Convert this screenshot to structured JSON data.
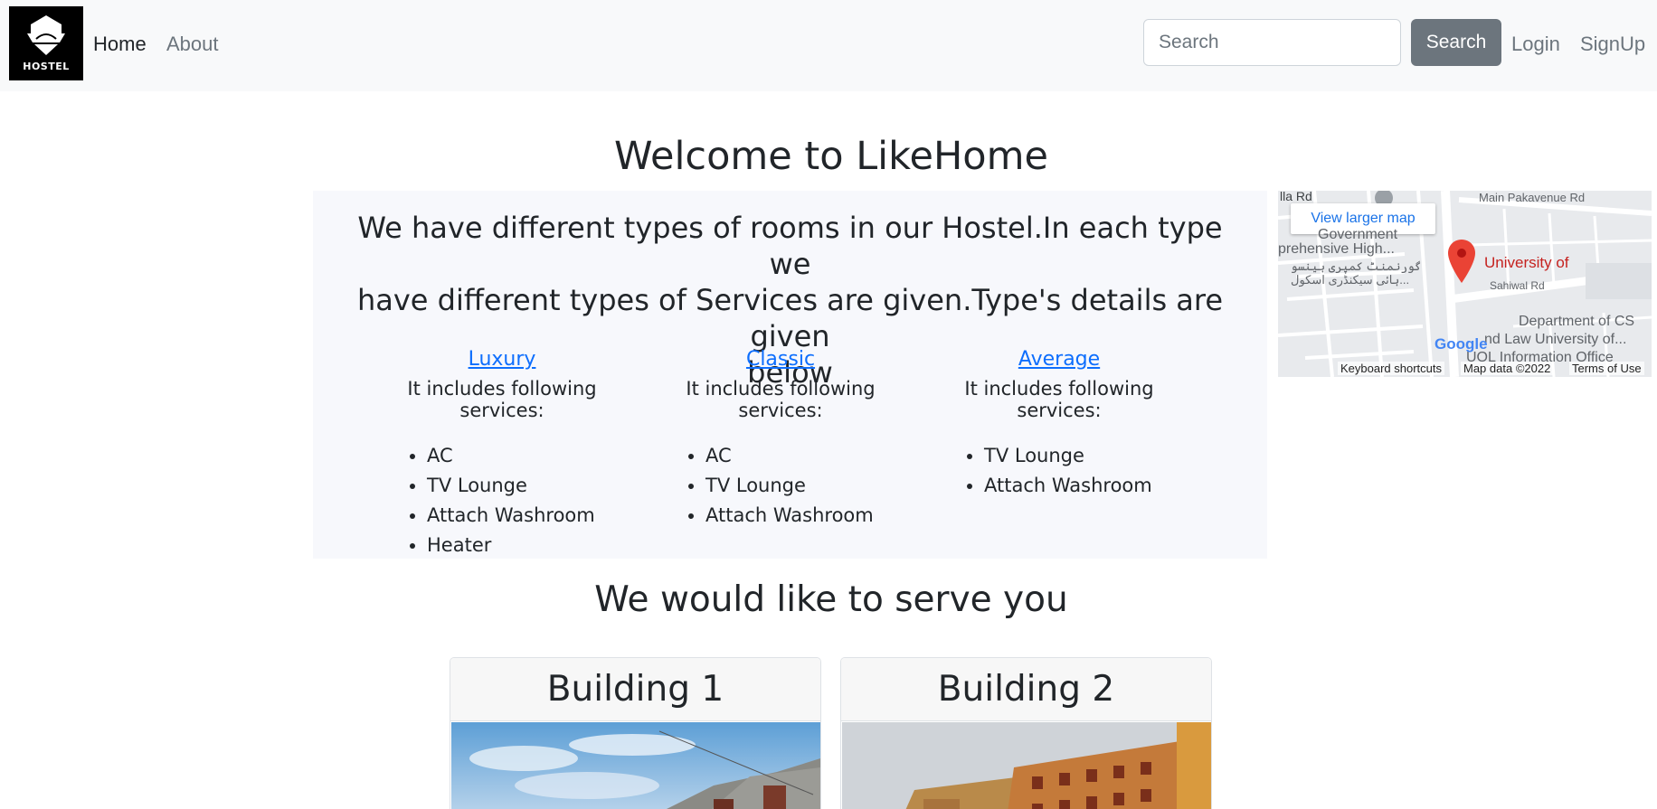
{
  "navbar": {
    "logo_text": "HOSTEL",
    "links": [
      "Home",
      "About"
    ],
    "search_placeholder": "Search",
    "search_button": "Search",
    "login": "Login",
    "signup": "SignUp"
  },
  "main": {
    "title": "Welcome to LikeHome",
    "intro_lines": [
      "We have different types of rooms in our Hostel.In each type we",
      "have different types of Services are given.Type's details are given",
      "below"
    ],
    "types": [
      {
        "name": "Luxury",
        "subtitle": "It includes following services:",
        "services": [
          "AC",
          "TV Lounge",
          "Attach Washroom",
          "Heater"
        ]
      },
      {
        "name": "Classic",
        "subtitle": "It includes following services:",
        "services": [
          "AC",
          "TV Lounge",
          "Attach Washroom"
        ]
      },
      {
        "name": "Average",
        "subtitle": "It includes following services:",
        "services": [
          "TV Lounge",
          "Attach Washroom"
        ]
      }
    ]
  },
  "map": {
    "view_larger": "View larger map",
    "labels": {
      "road1": "lla Rd",
      "road2": "Main Pakavenue Rd",
      "school1": "Government",
      "school2": "prehensive High...",
      "urdu1": "گورنمنٹ کمپری ہینسو",
      "urdu2": "ہائی سیکنڈری اسکول...",
      "pin": "University of",
      "road3": "Sahiwal Rd",
      "dept1": "Department of CS",
      "dept2": "nd Law University of...",
      "dept3": "UOL Information Office"
    },
    "footer": [
      "Keyboard shortcuts",
      "Map data ©2022",
      "Terms of Use"
    ],
    "google": "Google"
  },
  "serve": {
    "title": "We would like to serve you",
    "cards": [
      "Building 1",
      "Building 2"
    ]
  },
  "colors": {
    "navbar_bg": "#f8f9fa",
    "link_blue": "#0d6efd",
    "button_gray": "#6c757d",
    "info_bg": "#f7f8fc",
    "map_pin": "#ea4335"
  }
}
